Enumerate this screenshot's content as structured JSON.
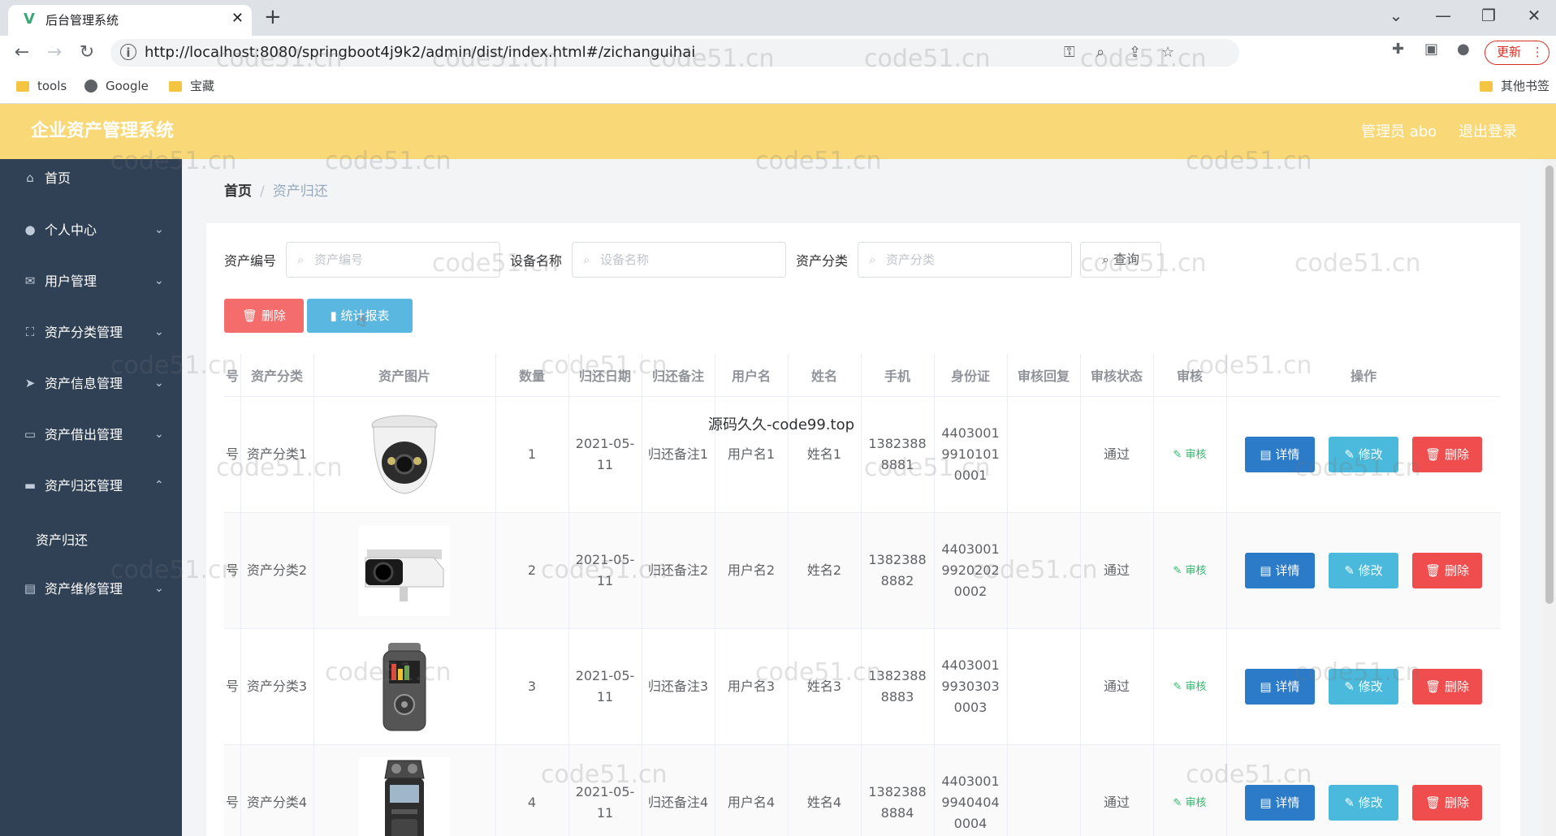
{
  "browser": {
    "tab_title": "后台管理系统",
    "url": "http://localhost:8080/springboot4j9k2/admin/dist/index.html#/zichanguihai",
    "update_label": "更新",
    "bookmarks": [
      "tools",
      "Google",
      "宝藏"
    ],
    "other_bookmarks": "其他书签"
  },
  "header": {
    "title": "企业资产管理系统",
    "user": "管理员 abo",
    "logout": "退出登录"
  },
  "sidebar": {
    "items": [
      {
        "label": "首页",
        "icon": "home-icon"
      },
      {
        "label": "个人中心",
        "icon": "user-icon"
      },
      {
        "label": "用户管理",
        "icon": "message-icon"
      },
      {
        "label": "资产分类管理",
        "icon": "scan-icon"
      },
      {
        "label": "资产信息管理",
        "icon": "send-icon"
      },
      {
        "label": "资产借出管理",
        "icon": "chat-icon"
      },
      {
        "label": "资产归还管理",
        "icon": "tray-icon"
      },
      {
        "label": "资产维修管理",
        "icon": "clipboard-icon"
      }
    ],
    "sub_item": "资产归还"
  },
  "breadcrumb": {
    "home": "首页",
    "current": "资产归还"
  },
  "search": {
    "fields": [
      {
        "label": "资产编号",
        "placeholder": "资产编号"
      },
      {
        "label": "设备名称",
        "placeholder": "设备名称"
      },
      {
        "label": "资产分类",
        "placeholder": "资产分类"
      }
    ],
    "query_label": "查询"
  },
  "actions": {
    "delete_label": "删除",
    "report_label": "统计报表"
  },
  "table": {
    "headers": [
      "号",
      "资产分类",
      "资产图片",
      "数量",
      "归还日期",
      "归还备注",
      "用户名",
      "姓名",
      "手机",
      "身份证",
      "审核回复",
      "审核状态",
      "审核",
      "操作"
    ],
    "rows": [
      {
        "code": "号",
        "category": "资产分类1",
        "image": "dome-camera",
        "qty": "1",
        "date": "2021-05-11",
        "note": "归还备注1",
        "username": "用户名1",
        "name": "姓名1",
        "phone": "13823888881",
        "idcard": "440300199101010001",
        "reply": "",
        "status": "通过",
        "audit": "审核"
      },
      {
        "code": "号",
        "category": "资产分类2",
        "image": "bullet-camera",
        "qty": "2",
        "date": "2021-05-11",
        "note": "归还备注2",
        "username": "用户名2",
        "name": "姓名2",
        "phone": "13823888882",
        "idcard": "440300199202020002",
        "reply": "",
        "status": "通过",
        "audit": "审核"
      },
      {
        "code": "号",
        "category": "资产分类3",
        "image": "audio-recorder",
        "qty": "3",
        "date": "2021-05-11",
        "note": "归还备注3",
        "username": "用户名3",
        "name": "姓名3",
        "phone": "13823888883",
        "idcard": "440300199303030003",
        "reply": "",
        "status": "通过",
        "audit": "审核"
      },
      {
        "code": "号",
        "category": "资产分类4",
        "image": "handheld-recorder",
        "qty": "4",
        "date": "2021-05-11",
        "note": "归还备注4",
        "username": "用户名4",
        "name": "姓名4",
        "phone": "13823888884",
        "idcard": "440300199404040004",
        "reply": "",
        "status": "通过",
        "audit": "审核"
      }
    ],
    "op_labels": {
      "detail": "详情",
      "edit": "修改",
      "delete": "删除"
    }
  },
  "overlay_text": "源码久久-code99.top",
  "watermark": "code51.cn",
  "colors": {
    "header_bg": "#f9d877",
    "sidebar_bg": "#304156",
    "danger": "#f56c6c",
    "primary": "#2b7bc8",
    "info": "#4ab9db",
    "success": "#2fb86b"
  }
}
